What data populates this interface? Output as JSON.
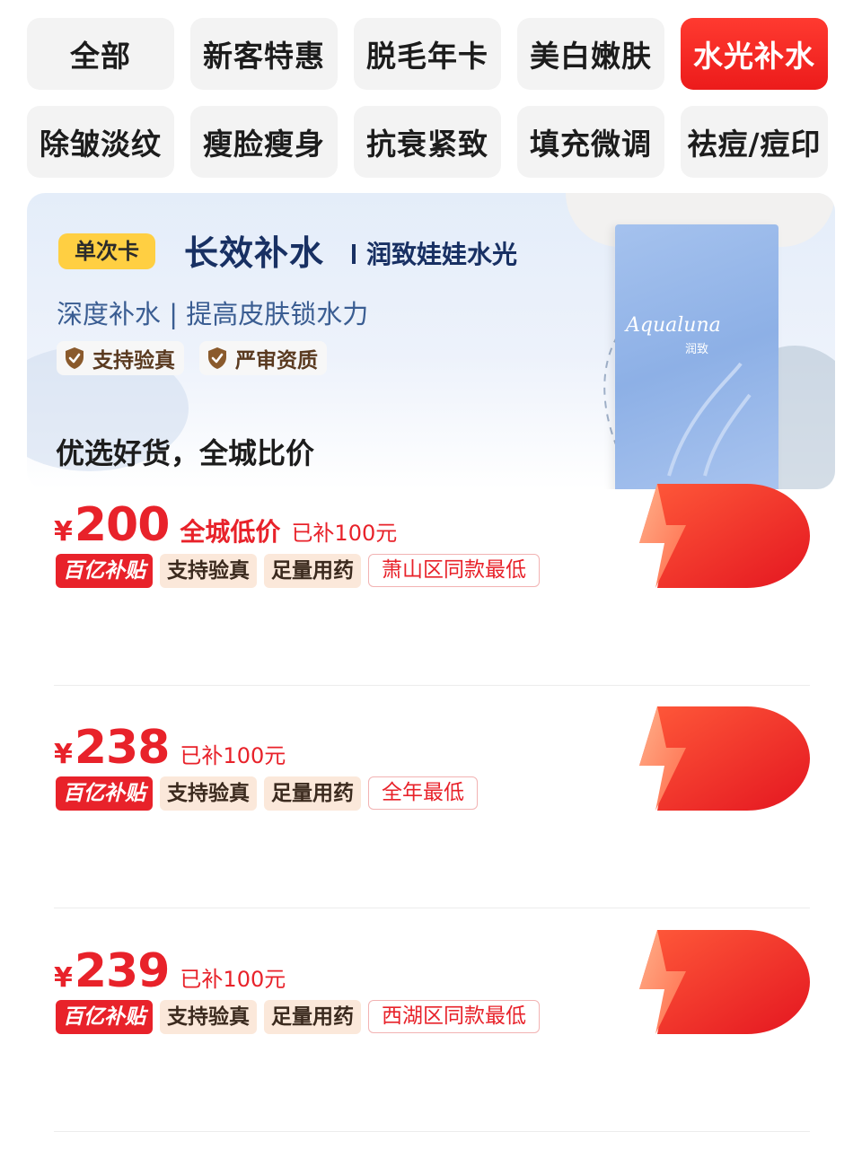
{
  "categories": [
    {
      "label": "全部",
      "active": false
    },
    {
      "label": "新客特惠",
      "active": false
    },
    {
      "label": "脱毛年卡",
      "active": false
    },
    {
      "label": "美白嫩肤",
      "active": false
    },
    {
      "label": "水光补水",
      "active": true
    },
    {
      "label": "除皱淡纹",
      "active": false
    },
    {
      "label": "瘦脸瘦身",
      "active": false
    },
    {
      "label": "抗衰紧致",
      "active": false
    },
    {
      "label": "填充微调",
      "active": false
    },
    {
      "label": "祛痘/痘印",
      "active": false
    }
  ],
  "banner": {
    "card_type": "单次卡",
    "title": "长效补水",
    "subtitle": "润致娃娃水光",
    "desc": "深度补水 | 提高皮肤锁水力",
    "badges": [
      "支持验真",
      "严审资质"
    ],
    "product_brand": "Aqualuna",
    "product_brand_cn": "润致"
  },
  "section_title": "优选好货，全城比价",
  "listings": [
    {
      "currency": "¥",
      "price": "200",
      "price_note": "全城低价",
      "subsidy": "已补100元",
      "tags": [
        "百亿补贴",
        "支持验真",
        "足量用药"
      ],
      "rank_tag": "萧山区同款最低"
    },
    {
      "currency": "¥",
      "price": "238",
      "price_note": "",
      "subsidy": "已补100元",
      "tags": [
        "百亿补贴",
        "支持验真",
        "足量用药"
      ],
      "rank_tag": "全年最低"
    },
    {
      "currency": "¥",
      "price": "239",
      "price_note": "",
      "subsidy": "已补100元",
      "tags": [
        "百亿补贴",
        "支持验真",
        "足量用药"
      ],
      "rank_tag": "西湖区同款最低"
    }
  ],
  "colors": {
    "accent_red": "#e8222a",
    "badge_yellow": "#ffcf42",
    "banner_navy": "#183063"
  }
}
